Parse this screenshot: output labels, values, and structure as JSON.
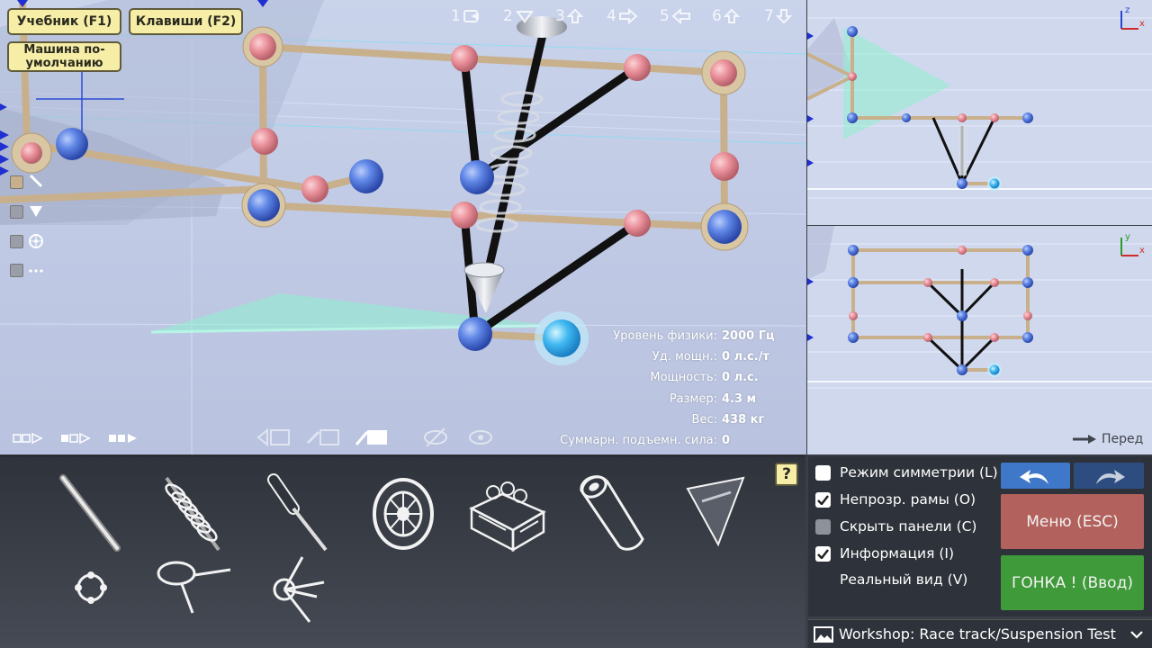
{
  "viewport": {
    "buttons": {
      "tutorial": "Учебник (F1)",
      "keys": "Клавиши (F2)",
      "default_car": "Машина по-умолчанию"
    },
    "view_keys": [
      "1",
      "2",
      "3",
      "4",
      "5",
      "6",
      "7"
    ],
    "info": [
      {
        "label": "Уровень физики:",
        "value": "2000 Гц"
      },
      {
        "label": "Уд. мощн.:",
        "value": "0 л.с./т"
      },
      {
        "label": "Мощность:",
        "value": "0 л.с."
      },
      {
        "label": "Размер:",
        "value": "4.3 м"
      },
      {
        "label": "Вес:",
        "value": "438 кг"
      },
      {
        "label": "Суммарн. подъемн. сила:",
        "value": "0"
      }
    ]
  },
  "side_views": {
    "front_label": "Перед",
    "axes_top": {
      "a": "z",
      "b": "x"
    },
    "axes_front": {
      "a": "y",
      "b": "x"
    }
  },
  "parts": {
    "help": "?",
    "items": [
      "beam",
      "spring",
      "actuator",
      "wheel",
      "engine",
      "jet",
      "wing",
      "node",
      "steering",
      "rotary-joint"
    ]
  },
  "options": {
    "symmetry": "Режим симметрии (L)",
    "opaque_frames": "Непрозр. рамы (O)",
    "hide_panels": "Скрыть панели (C)",
    "info": "Информация (I)",
    "real_view": "Реальный вид (V)",
    "menu": "Меню (ESC)",
    "race": "ГОНКА ! (Ввод)"
  },
  "track": {
    "label": "Workshop:  Race track/Suspension Test"
  },
  "colors": {
    "accent_blue": "#3f77c9",
    "menu_red": "#b2615c",
    "race_green": "#3f9a3a",
    "button_yellow": "#f6eda6"
  }
}
